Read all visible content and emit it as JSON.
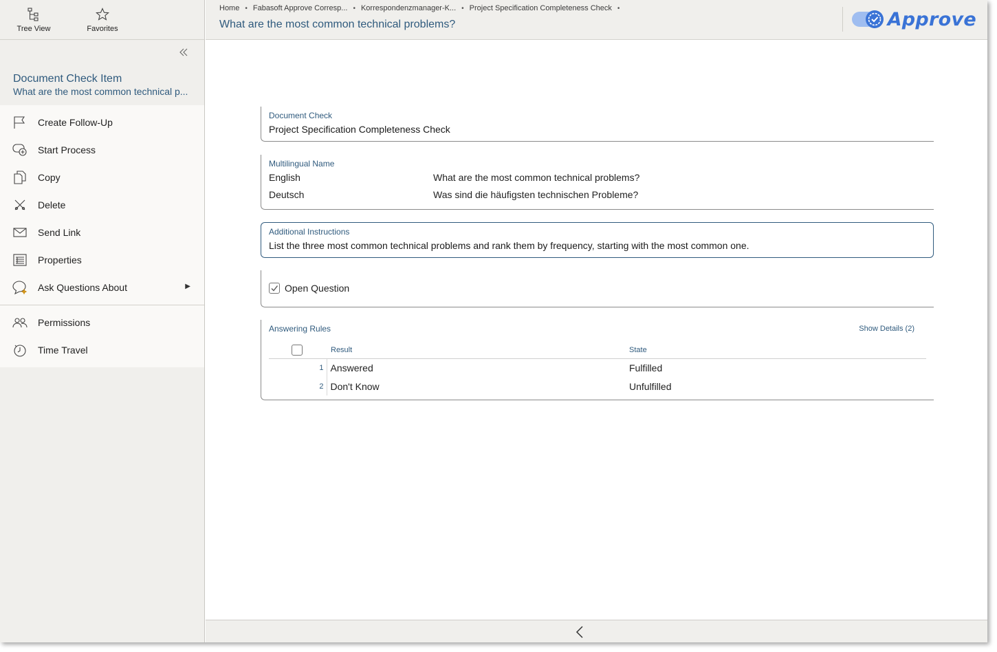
{
  "sidebar": {
    "top_buttons": [
      {
        "label": "Tree View",
        "icon": "tree-view-icon"
      },
      {
        "label": "Favorites",
        "icon": "star-icon"
      }
    ],
    "object_type": "Document Check Item",
    "object_name": "What are the most common technical p...",
    "menu_group1": [
      {
        "label": "Create Follow-Up",
        "icon": "flag-icon"
      },
      {
        "label": "Start Process",
        "icon": "start-process-icon"
      },
      {
        "label": "Copy",
        "icon": "copy-icon"
      },
      {
        "label": "Delete",
        "icon": "delete-icon"
      },
      {
        "label": "Send Link",
        "icon": "envelope-icon"
      },
      {
        "label": "Properties",
        "icon": "properties-icon"
      },
      {
        "label": "Ask Questions About",
        "icon": "chat-sparkle-icon"
      }
    ],
    "menu_group2": [
      {
        "label": "Permissions",
        "icon": "people-icon"
      },
      {
        "label": "Time Travel",
        "icon": "clock-icon"
      }
    ]
  },
  "header": {
    "breadcrumbs": [
      "Home",
      "Fabasoft Approve Corresp...",
      "Korrespondenzmanager-K...",
      "Project Specification Completeness Check"
    ],
    "title": "What are the most common technical problems?",
    "logo_text": "Approve",
    "brand_color": "#3a73d6"
  },
  "main": {
    "document_check": {
      "label": "Document Check",
      "value": "Project Specification Completeness Check"
    },
    "multilingual": {
      "label": "Multilingual Name",
      "rows": [
        {
          "lang": "English",
          "text": "What are the most common technical problems?"
        },
        {
          "lang": "Deutsch",
          "text": "Was sind die häufigsten technischen Probleme?"
        }
      ]
    },
    "instructions": {
      "label": "Additional Instructions",
      "value": "List the three most common technical problems and rank them by frequency, starting with the most common one."
    },
    "open_question": {
      "label": "Open Question",
      "checked": true
    },
    "answering_rules": {
      "label": "Answering Rules",
      "show_details": "Show Details (2)",
      "columns": [
        "Result",
        "State"
      ],
      "rows": [
        {
          "num": "1",
          "result": "Answered",
          "state": "Fulfilled"
        },
        {
          "num": "2",
          "result": "Don't Know",
          "state": "Unfulfilled"
        }
      ]
    }
  }
}
